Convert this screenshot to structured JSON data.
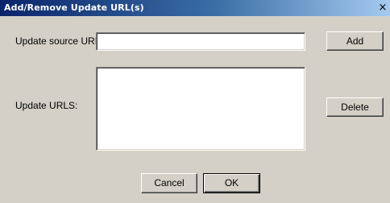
{
  "dialog": {
    "title": "Add/Remove Update URL(s)",
    "close_glyph": "×"
  },
  "form": {
    "source_label": "Update source URL:",
    "source_value": "",
    "source_placeholder": "",
    "urls_label": "Update URLS:",
    "urls_items": []
  },
  "buttons": {
    "add": "Add",
    "delete": "Delete",
    "cancel": "Cancel",
    "ok": "OK"
  }
}
